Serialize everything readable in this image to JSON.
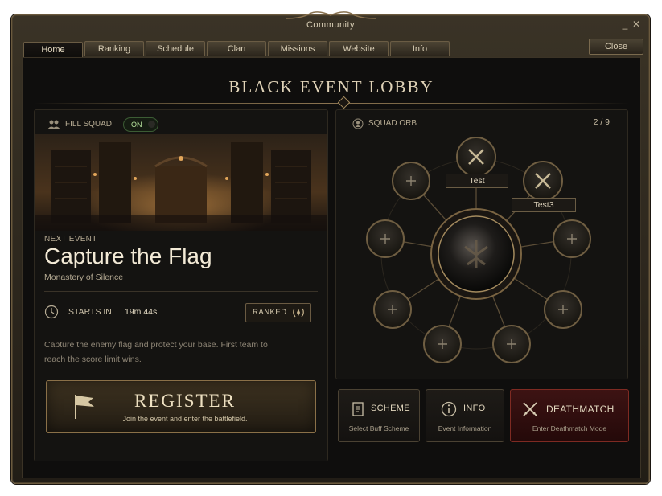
{
  "window": {
    "title": "Community",
    "minimize": "_",
    "close_x": "✕"
  },
  "tabs": [
    {
      "label": "Home",
      "active": true
    },
    {
      "label": "Ranking"
    },
    {
      "label": "Schedule"
    },
    {
      "label": "Clan"
    },
    {
      "label": "Missions"
    },
    {
      "label": "Website"
    },
    {
      "label": "Info"
    }
  ],
  "close_label": "Close",
  "lobby_title": "BLACK EVENT LOBBY",
  "fill_squad": {
    "label": "FILL SQUAD",
    "toggle": "ON"
  },
  "event": {
    "next_label": "NEXT EVENT",
    "name": "Capture the Flag",
    "location": "Monastery of Silence",
    "starts_label": "STARTS IN",
    "starts_value": "19m 44s",
    "mode_badge": "RANKED",
    "description": "Capture the enemy flag and protect your base. First team to reach the score limit wins."
  },
  "register": {
    "title": "REGISTER",
    "subtitle": "Join the event and enter the battlefield."
  },
  "squad_orb": {
    "title": "SQUAD ORB",
    "count": "2 / 9",
    "slots": [
      {
        "name": "Test",
        "filled": true
      },
      {
        "name": "Test3",
        "filled": true
      },
      {
        "name": "",
        "filled": false
      },
      {
        "name": "",
        "filled": false
      },
      {
        "name": "",
        "filled": false
      },
      {
        "name": "",
        "filled": false
      },
      {
        "name": "",
        "filled": false
      },
      {
        "name": "",
        "filled": false
      },
      {
        "name": "",
        "filled": false
      }
    ]
  },
  "actions": {
    "scheme": {
      "title": "SCHEME",
      "subtitle": "Select Buff Scheme",
      "icon": "scroll-icon"
    },
    "info": {
      "title": "INFO",
      "subtitle": "Event Information",
      "icon": "info-icon"
    },
    "deathmatch": {
      "title": "DEATHMATCH",
      "subtitle": "Enter Deathmatch Mode",
      "icon": "crossed-swords-icon"
    }
  },
  "colors": {
    "accent_gold": "#a38a5e",
    "toggle_on": "#b9e69f",
    "deathmatch_red": "#7e2a22"
  }
}
